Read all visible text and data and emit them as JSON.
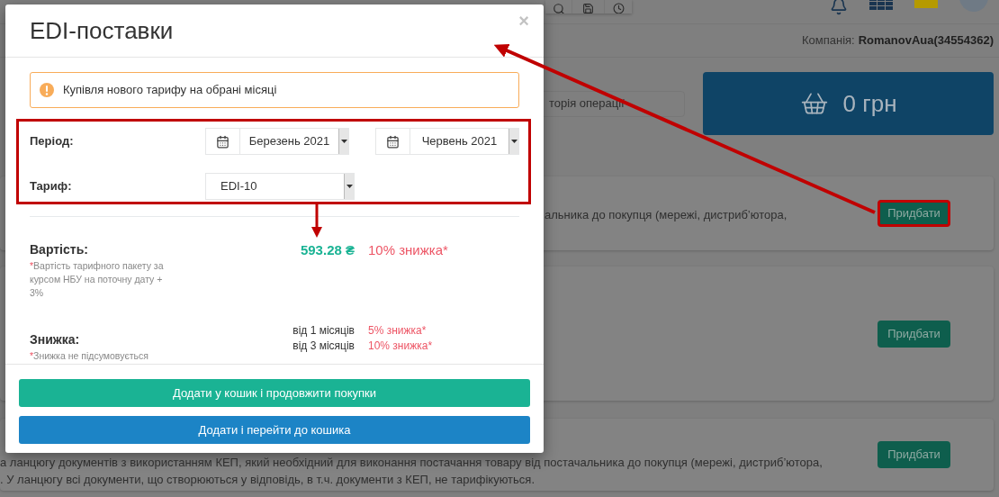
{
  "header": {
    "company_label": "Компанія:",
    "company_name": "RomanovAua(34554362)"
  },
  "history_field": {
    "value": "торія операції"
  },
  "cart": {
    "total": "0 грн"
  },
  "offers": [
    {
      "lines": [
        "альника до покупця (мережі, дистриб’ютора,"
      ],
      "button": "Придбати",
      "highlighted": true
    },
    {
      "button": "Придбати",
      "highlighted": false
    },
    {
      "lines": [
        "а ланцюгу документів з використанням КЕП, який необхідний для виконання постачання товару від постачальника до покупця (мережі, дистриб’ютора,",
        ". У ланцюгу всі документи, що створюються у відповідь, в т.ч. документи з КЕП, не тарифікуються."
      ],
      "button": "Придбати",
      "highlighted": false
    }
  ],
  "modal": {
    "title": "EDI-поставки",
    "close": "×",
    "alert": "Купівля нового тарифу на обрані місяці",
    "period_label": "Період:",
    "period_from": "Березень 2021",
    "period_to": "Червень 2021",
    "tariff_label": "Тариф:",
    "tariff": "EDI-10",
    "cost_label": "Вартість:",
    "cost_note_mark": "*",
    "cost_note": "Вартість тарифного пакету за курсом НБУ на поточну дату + 3%",
    "price": "593.28 ₴",
    "price_discount": "10% знижка*",
    "discount_label": "Знижка:",
    "discount_note_mark": "*",
    "discount_note": "Знижка не підсумовується",
    "discount_tiers": [
      {
        "from": "від 1 місяців",
        "discount": "5% знижка*"
      },
      {
        "from": "від 3 місяців",
        "discount": "10% знижка*"
      }
    ],
    "buttons": [
      {
        "label": "Додати у кошик і продовжити покупки",
        "kind": "green"
      },
      {
        "label": "Додати і перейти до кошика",
        "kind": "blue"
      }
    ]
  }
}
